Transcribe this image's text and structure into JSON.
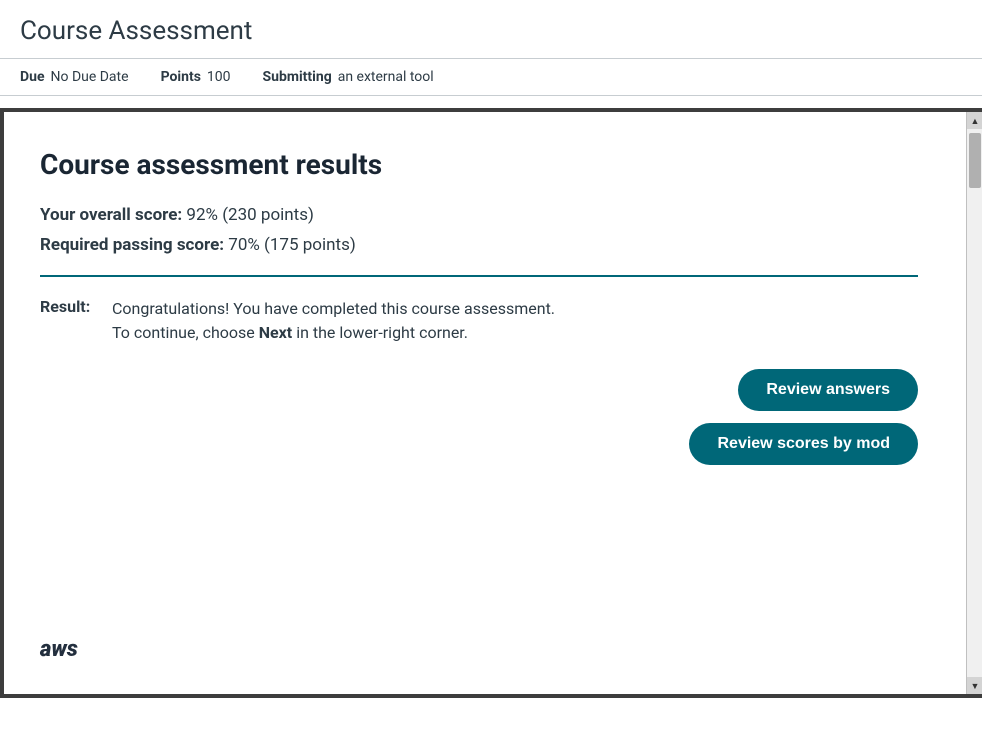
{
  "page": {
    "title": "Course Assessment"
  },
  "meta": {
    "due_label": "Due",
    "due_value": "No Due Date",
    "points_label": "Points",
    "points_value": "100",
    "submitting_label": "Submitting",
    "submitting_value": "an external tool"
  },
  "results": {
    "title": "Course assessment results",
    "overall_score_label": "Your overall score:",
    "overall_score_value": "92% (230 points)",
    "passing_score_label": "Required passing score:",
    "passing_score_value": "70% (175 points)",
    "result_label": "Result:",
    "result_text_line1": "Congratulations! You have completed this course assessment.",
    "result_text_line2": "To continue, choose ",
    "result_text_bold": "Next",
    "result_text_line2_end": " in the lower-right corner.",
    "btn_review_answers": "Review answers",
    "btn_review_scores": "Review scores by mod"
  },
  "aws_logo": "aws"
}
